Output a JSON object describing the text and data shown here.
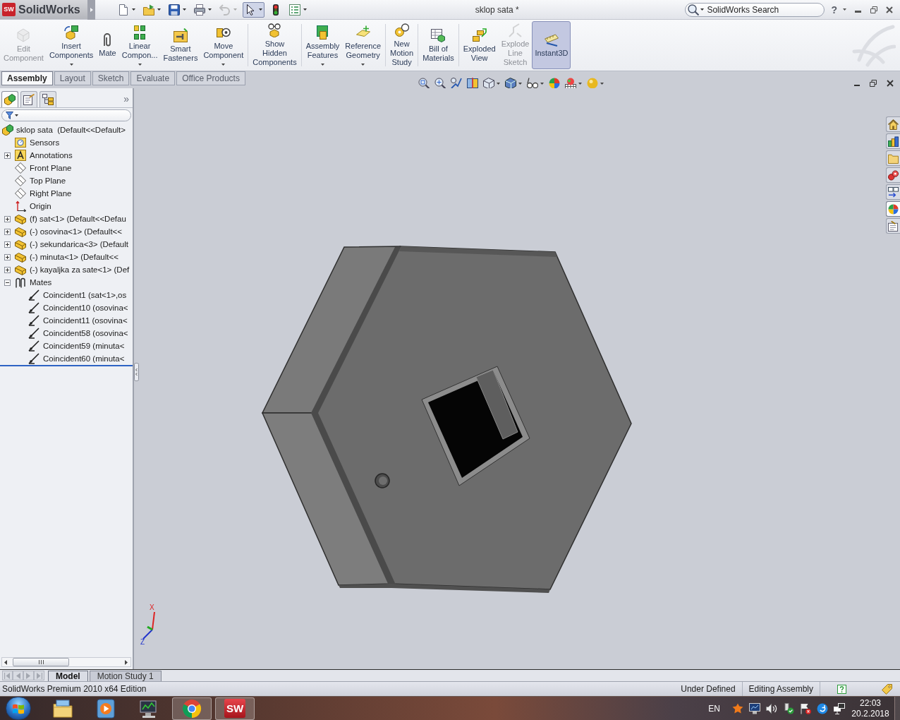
{
  "title_bar": {
    "logo_mark": "SW",
    "app_name": "SolidWorks",
    "quick_access": [
      {
        "kind": "new",
        "menu": true,
        "disabled": false,
        "pressed": false
      },
      {
        "kind": "open",
        "menu": true,
        "disabled": false,
        "pressed": false
      },
      {
        "kind": "save",
        "menu": true,
        "disabled": false,
        "pressed": false
      },
      {
        "kind": "print",
        "menu": true,
        "disabled": false,
        "pressed": false
      },
      {
        "kind": "undo",
        "menu": true,
        "disabled": true,
        "pressed": false
      },
      {
        "kind": "select",
        "menu": true,
        "disabled": false,
        "pressed": true
      },
      {
        "kind": "rebuild",
        "menu": false,
        "disabled": false,
        "pressed": false
      },
      {
        "kind": "options",
        "menu": true,
        "disabled": false,
        "pressed": false
      }
    ],
    "title": "sklop sata *",
    "search": {
      "placeholder": "SolidWorks Search"
    },
    "help": "?"
  },
  "command_manager": {
    "groups": [
      {
        "buttons": [
          {
            "kind": "edit_component",
            "label": "Edit\nComponent",
            "menu": false,
            "disabled": true,
            "pressed": false
          },
          {
            "kind": "insert_components",
            "label": "Insert\nComponents",
            "menu": true,
            "disabled": false,
            "pressed": false
          },
          {
            "kind": "mate",
            "label": "Mate",
            "menu": false,
            "disabled": false,
            "pressed": false
          },
          {
            "kind": "linear_pattern",
            "label": "Linear\nCompon...",
            "menu": true,
            "disabled": false,
            "pressed": false
          },
          {
            "kind": "smart_fasteners",
            "label": "Smart\nFasteners",
            "menu": false,
            "disabled": false,
            "pressed": false
          },
          {
            "kind": "move_component",
            "label": "Move\nComponent",
            "menu": true,
            "disabled": false,
            "pressed": false
          }
        ]
      },
      {
        "buttons": [
          {
            "kind": "show_hidden",
            "label": "Show\nHidden\nComponents",
            "menu": false,
            "disabled": false,
            "pressed": false
          }
        ]
      },
      {
        "buttons": [
          {
            "kind": "assembly_features",
            "label": "Assembly\nFeatures",
            "menu": true,
            "disabled": false,
            "pressed": false
          },
          {
            "kind": "reference_geometry",
            "label": "Reference\nGeometry",
            "menu": true,
            "disabled": false,
            "pressed": false
          }
        ]
      },
      {
        "buttons": [
          {
            "kind": "motion_study",
            "label": "New\nMotion\nStudy",
            "menu": false,
            "disabled": false,
            "pressed": false
          }
        ]
      },
      {
        "buttons": [
          {
            "kind": "bill_of_materials",
            "label": "Bill of\nMaterials",
            "menu": false,
            "disabled": false,
            "pressed": false
          }
        ]
      },
      {
        "buttons": [
          {
            "kind": "exploded_view",
            "label": "Exploded\nView",
            "menu": false,
            "disabled": false,
            "pressed": false
          },
          {
            "kind": "explode_line",
            "label": "Explode\nLine\nSketch",
            "menu": false,
            "disabled": true,
            "pressed": false
          },
          {
            "kind": "instant3d",
            "label": "Instant3D",
            "menu": false,
            "disabled": false,
            "pressed": true
          }
        ]
      }
    ],
    "tabs": [
      {
        "label": "Assembly",
        "selected": true
      },
      {
        "label": "Layout",
        "selected": false
      },
      {
        "label": "Sketch",
        "selected": false
      },
      {
        "label": "Evaluate",
        "selected": false
      },
      {
        "label": "Office Products",
        "selected": false
      }
    ]
  },
  "view_toolbar": [
    {
      "kind": "zoom_fit",
      "menu": false
    },
    {
      "kind": "zoom_area",
      "menu": false
    },
    {
      "kind": "previous_view",
      "menu": false
    },
    {
      "kind": "section_view",
      "menu": false
    },
    {
      "kind": "view_orientation",
      "menu": true
    },
    {
      "kind": "display_style",
      "menu": true
    },
    {
      "kind": "hide_show",
      "menu": true
    },
    {
      "kind": "edit_appearance",
      "menu": false
    },
    {
      "kind": "apply_scene",
      "menu": true
    },
    {
      "kind": "view_settings",
      "menu": true
    }
  ],
  "feature_tree": {
    "panel_tabs": [
      {
        "kind": "feature_manager",
        "selected": true
      },
      {
        "kind": "property_manager",
        "selected": false
      },
      {
        "kind": "configuration_manager",
        "selected": false
      }
    ],
    "more": "»",
    "items": [
      {
        "kind": "assembly",
        "label": "sklop sata  (Default<<Default>",
        "selected": false,
        "children": [
          {
            "kind": "sensors",
            "label": "Sensors",
            "selected": false
          },
          {
            "kind": "annotations",
            "label": "Annotations",
            "selected": false,
            "expanded": false
          },
          {
            "kind": "plane",
            "label": "Front Plane",
            "selected": false
          },
          {
            "kind": "plane",
            "label": "Top Plane",
            "selected": false
          },
          {
            "kind": "plane",
            "label": "Right Plane",
            "selected": false
          },
          {
            "kind": "origin",
            "label": "Origin",
            "selected": false
          },
          {
            "kind": "part",
            "label": "(f) sat<1> (Default<<Defau",
            "selected": false,
            "expanded": false
          },
          {
            "kind": "part",
            "label": "(-) osovina<1> (Default<<",
            "selected": false,
            "expanded": false
          },
          {
            "kind": "part",
            "label": "(-) sekundarica<3> (Default",
            "selected": false,
            "expanded": false
          },
          {
            "kind": "part",
            "label": "(-) minuta<1> (Default<<",
            "selected": false,
            "expanded": false
          },
          {
            "kind": "part",
            "label": "(-) kayaljka za sate<1> (Def",
            "selected": false,
            "expanded": false
          },
          {
            "kind": "mates",
            "label": "Mates",
            "selected": false,
            "expanded": true,
            "children": [
              {
                "kind": "coincident",
                "label": "Coincident1 (sat<1>,os",
                "selected": false
              },
              {
                "kind": "coincident",
                "label": "Coincident10 (osovina<",
                "selected": false
              },
              {
                "kind": "coincident",
                "label": "Coincident11 (osovina<",
                "selected": false
              },
              {
                "kind": "coincident",
                "label": "Coincident58 (osovina<",
                "selected": false
              },
              {
                "kind": "coincident",
                "label": "Coincident59 (minuta<",
                "selected": false
              },
              {
                "kind": "coincident",
                "label": "Coincident60 (minuta<",
                "selected": false
              }
            ]
          }
        ]
      }
    ]
  },
  "viewport": {
    "triad_labels": [
      "X",
      "Z"
    ]
  },
  "task_pane": [
    {
      "kind": "home",
      "selected": false
    },
    {
      "kind": "library",
      "selected": false
    },
    {
      "kind": "folder",
      "selected": false
    },
    {
      "kind": "resources",
      "selected": false
    },
    {
      "kind": "palette",
      "selected": false
    },
    {
      "kind": "appearances",
      "selected": true
    },
    {
      "kind": "properties",
      "selected": false
    }
  ],
  "bottom_tabs": {
    "scroll_buttons": [
      {
        "kind": "first",
        "disabled": true
      },
      {
        "kind": "previous",
        "disabled": true
      },
      {
        "kind": "next",
        "disabled": true
      },
      {
        "kind": "last",
        "disabled": true
      }
    ],
    "tabs": [
      {
        "label": "Model",
        "selected": true
      },
      {
        "label": "Motion Study 1",
        "selected": false
      }
    ]
  },
  "status_bar": {
    "edition": "SolidWorks Premium 2010 x64 Edition",
    "fields": [
      "Under Defined",
      "Editing Assembly"
    ]
  },
  "taskbar": {
    "apps": [
      {
        "kind": "explorer",
        "running": false
      },
      {
        "kind": "media_player",
        "running": false
      },
      {
        "kind": "monitor",
        "running": false
      },
      {
        "kind": "browser",
        "running": true
      },
      {
        "kind": "solidworks",
        "running": true,
        "mark": "SW"
      }
    ],
    "language": "EN",
    "tray": [
      {
        "kind": "antivirus"
      },
      {
        "kind": "display"
      },
      {
        "kind": "volume"
      },
      {
        "kind": "usb"
      },
      {
        "kind": "action_center"
      },
      {
        "kind": "sync"
      },
      {
        "kind": "network"
      }
    ],
    "time": "22:03",
    "date": "20.2.2018"
  }
}
